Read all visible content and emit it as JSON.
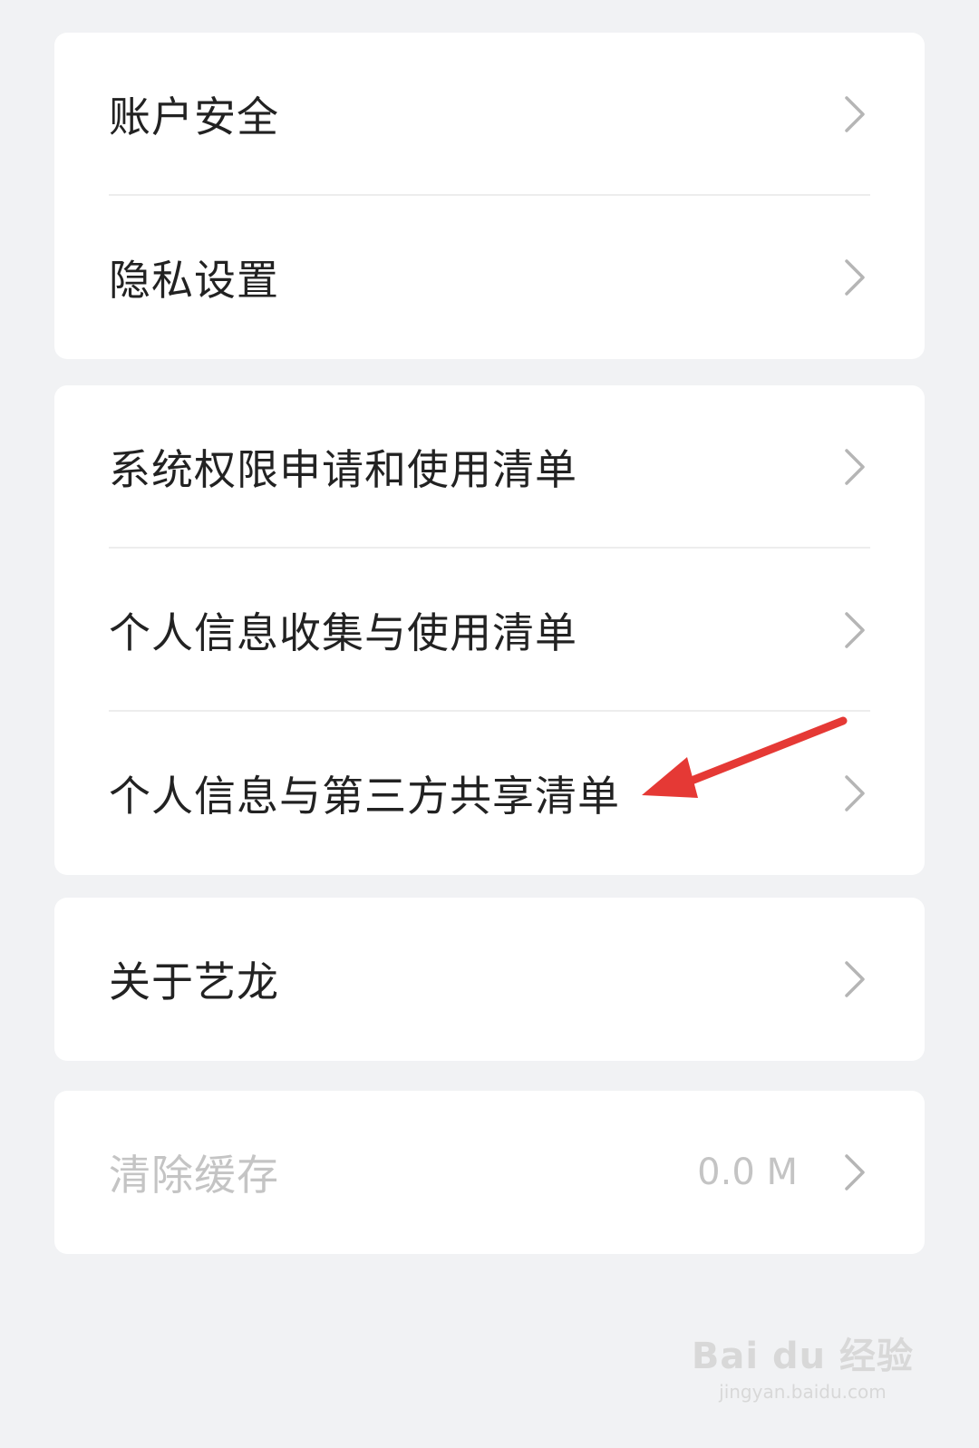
{
  "groups": [
    {
      "items": [
        {
          "label": "账户安全"
        },
        {
          "label": "隐私设置"
        }
      ]
    },
    {
      "items": [
        {
          "label": "系统权限申请和使用清单"
        },
        {
          "label": "个人信息收集与使用清单"
        },
        {
          "label": "个人信息与第三方共享清单"
        }
      ]
    },
    {
      "items": [
        {
          "label": "关于艺龙"
        }
      ]
    },
    {
      "items": [
        {
          "label": "清除缓存",
          "value": "0.0 M"
        }
      ]
    }
  ],
  "annotation": {
    "color": "#e53935"
  },
  "watermark": {
    "logo": "Bai du 经验",
    "url": "jingyan.baidu.com"
  }
}
